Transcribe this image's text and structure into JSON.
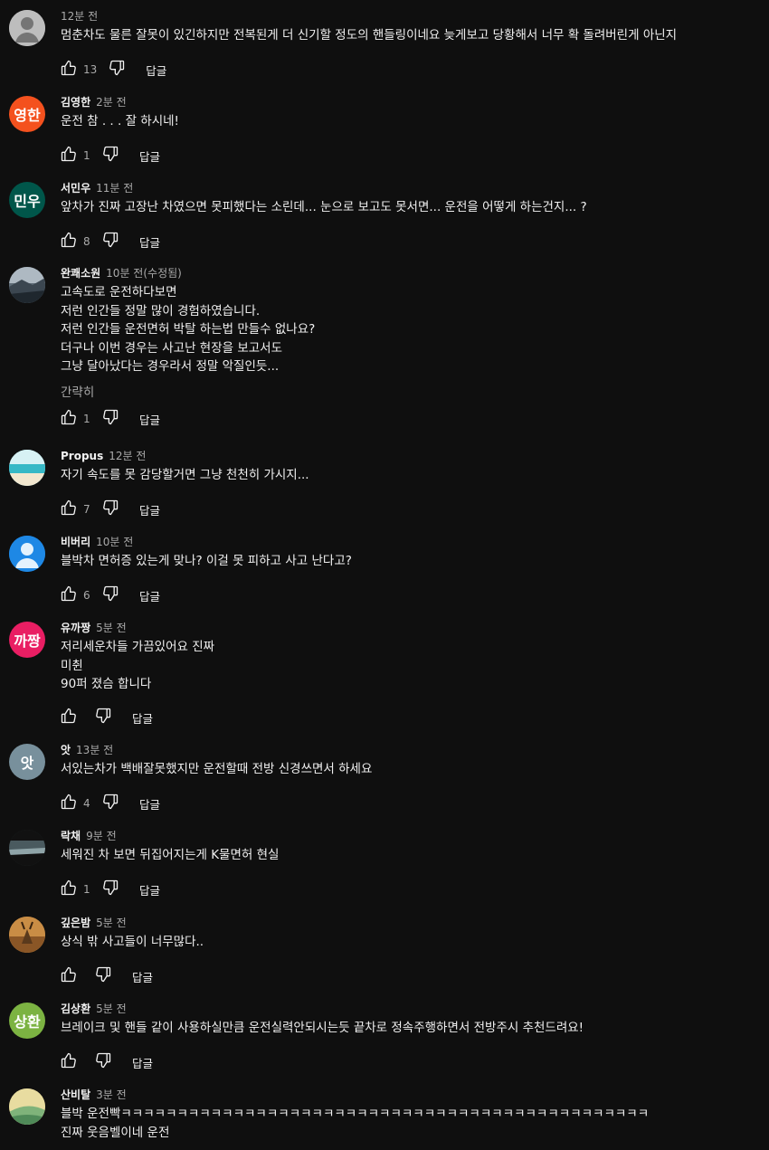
{
  "labels": {
    "reply": "답글",
    "edited_suffix": "(수정됨)",
    "read_less": "간략히"
  },
  "colors": {
    "background": "#0f0f0f",
    "text": "#f1f1f1",
    "secondary": "#aaaaaa"
  },
  "comments": [
    {
      "author": "",
      "time": "12분 전",
      "avatar_text": "",
      "avatar_color": "#bcbcbc",
      "avatar_type": "default-person",
      "lines": [
        "멈춘차도 물른 잘못이 있긴하지만 전복된게 더 신기할 정도의 핸들링이네요 늦게보고 당황해서 너무 확 돌려버린게 아닌지"
      ],
      "likes": "13"
    },
    {
      "author": "김영한",
      "time": "2분 전",
      "avatar_text": "영한",
      "avatar_color": "#f4511e",
      "avatar_type": "initials",
      "lines": [
        "운전 참 . . . 잘 하시네!"
      ],
      "likes": "1"
    },
    {
      "author": "서민우",
      "time": "11분 전",
      "avatar_text": "민우",
      "avatar_color": "#00564a",
      "avatar_type": "initials",
      "lines": [
        "앞차가 진짜 고장난 차였으면 못피했다는 소린데... 눈으로 보고도 못서면... 운전을 어떻게 하는건지... ?"
      ],
      "likes": "8"
    },
    {
      "author": "완쾌소원",
      "time": "10분 전",
      "edited": "(수정됨)",
      "avatar_text": "",
      "avatar_color": "#6f7a84",
      "avatar_type": "photo-landscape",
      "lines": [
        "고속도로 운전하다보면",
        "저런 인간들 정말 많이 경험하였습니다.",
        "저런 인간들 운전면허 박탈 하는법 만들수 없나요?",
        "더구나 이번 경우는 사고난 현장을 보고서도",
        "그냥 달아났다는 경우라서 정말 악질인듯..."
      ],
      "read_less": "간략히",
      "likes": "1"
    },
    {
      "author": "Propus",
      "time": "12분 전",
      "avatar_text": "",
      "avatar_color": "#7fd0d6",
      "avatar_type": "photo-beach",
      "lines": [
        "자기 속도를 못 감당할거면 그냥 천천히 가시지..."
      ],
      "likes": "7"
    },
    {
      "author": "비버리",
      "time": "10분 전",
      "avatar_text": "",
      "avatar_color": "#1e88e5",
      "avatar_type": "blue-person",
      "lines": [
        "블박차 면허증 있는게 맞나?  이걸 못 피하고 사고 난다고?"
      ],
      "likes": "6"
    },
    {
      "author": "유까짱",
      "time": "5분 전",
      "avatar_text": "까짱",
      "avatar_color": "#e91e63",
      "avatar_type": "initials",
      "lines": [
        "저리세운차들 가끔있어요 진짜",
        "미췬",
        "90퍼 졌슴 합니다"
      ],
      "likes": ""
    },
    {
      "author": "앗",
      "time": "13분 전",
      "avatar_text": "앗",
      "avatar_color": "#78909c",
      "avatar_type": "initials",
      "lines": [
        "서있는차가 백배잘못했지만 운전할때 전방 신경쓰면서 하세요"
      ],
      "likes": "4"
    },
    {
      "author": "락채",
      "time": "9분 전",
      "avatar_text": "",
      "avatar_color": "#2a3a3a",
      "avatar_type": "photo-dark",
      "lines": [
        "세워진 차 보면 뒤집어지는게 K물면허 현실"
      ],
      "likes": "1"
    },
    {
      "author": "깊은밤",
      "time": "5분 전",
      "avatar_text": "",
      "avatar_color": "#b07a3a",
      "avatar_type": "photo-deer",
      "lines": [
        "상식 밖 사고들이 너무많다.."
      ],
      "likes": ""
    },
    {
      "author": "김상환",
      "time": "5분 전",
      "avatar_text": "상환",
      "avatar_color": "#7cb342",
      "avatar_type": "initials",
      "lines": [
        "브레이크 및 핸들 같이 사용하실만큼 운전실력안되시는듯 끝차로 정속주행하면서 전방주시 추천드려요!"
      ],
      "likes": ""
    },
    {
      "author": "산비탈",
      "time": "3분 전",
      "avatar_text": "",
      "avatar_color": "#d9c87a",
      "avatar_type": "photo-hill",
      "lines": [
        "블박 운전빡ㅋㅋㅋㅋㅋㅋㅋㅋㅋㅋㅋㅋㅋㅋㅋㅋㅋㅋㅋㅋㅋㅋㅋㅋㅋㅋㅋㅋㅋㅋㅋㅋㅋㅋㅋㅋㅋㅋㅋㅋㅋㅋㅋㅋㅋㅋㅋ",
        "진짜 웃음벨이네 운전"
      ],
      "likes": ""
    }
  ]
}
